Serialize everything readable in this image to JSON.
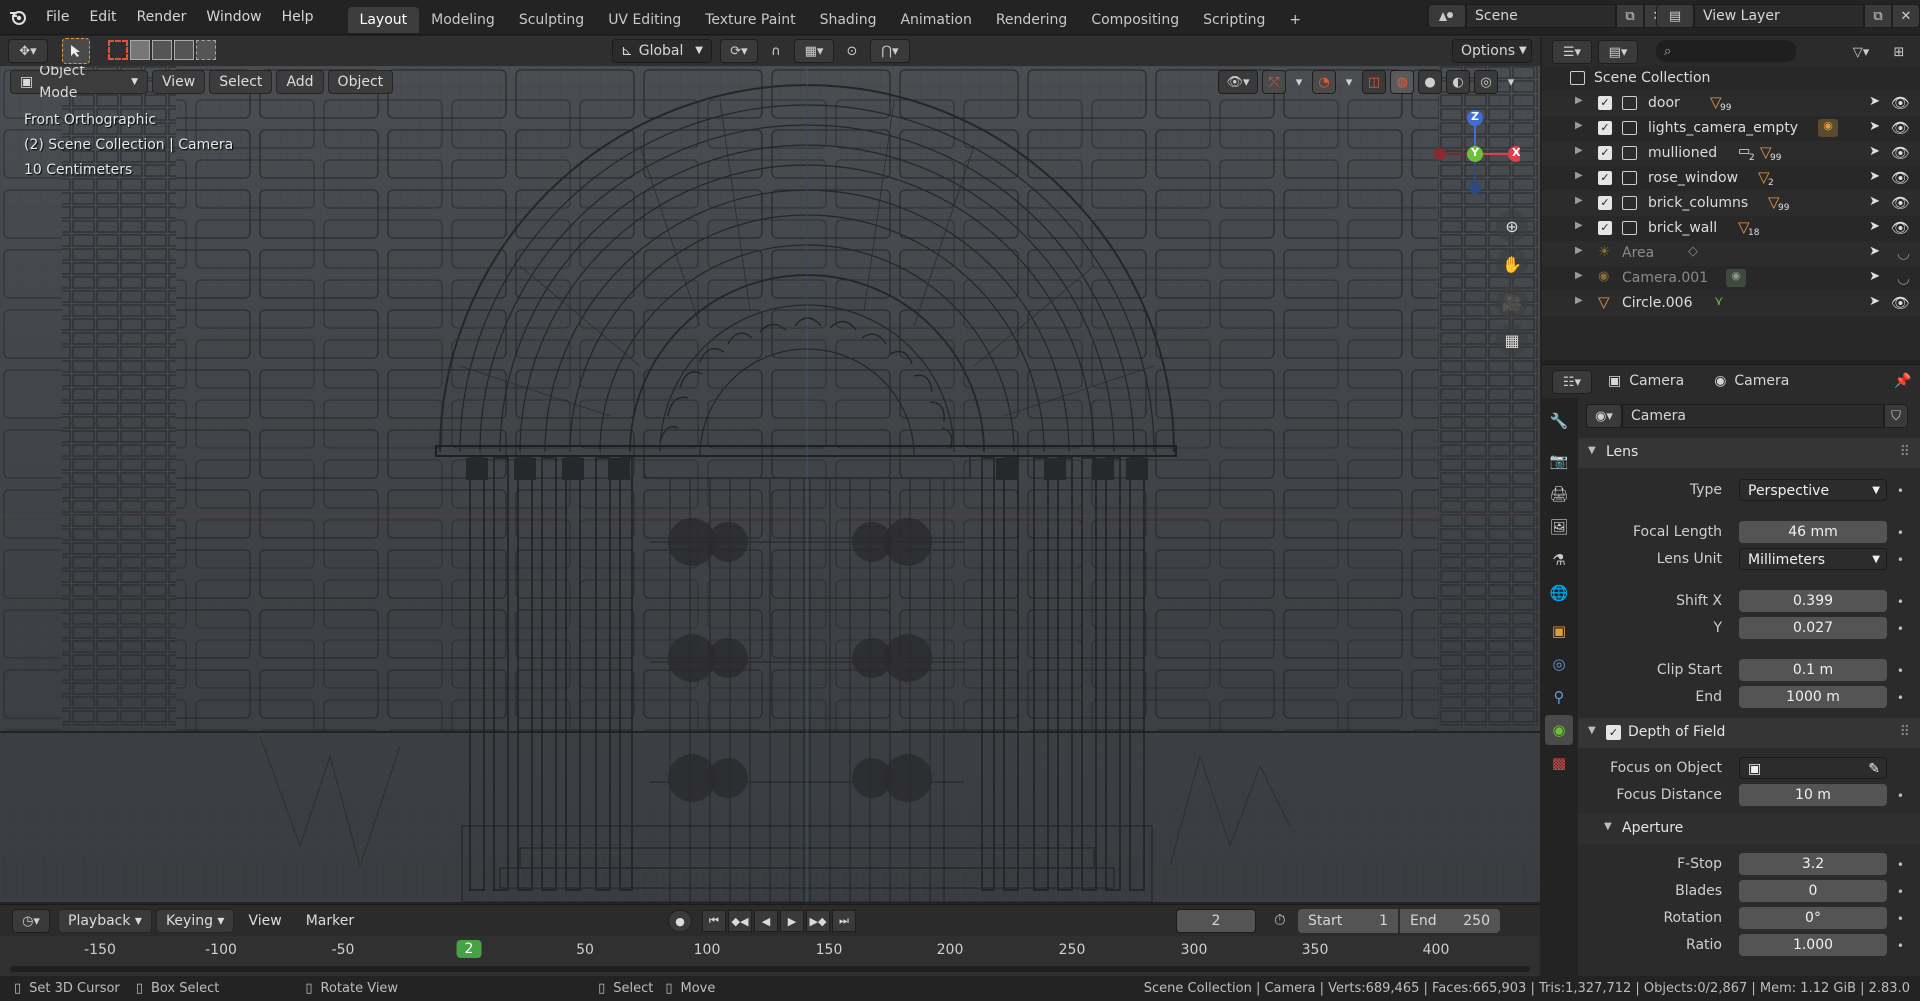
{
  "menubar": {
    "items": [
      "File",
      "Edit",
      "Render",
      "Window",
      "Help"
    ],
    "workspaces": [
      "Layout",
      "Modeling",
      "Sculpting",
      "UV Editing",
      "Texture Paint",
      "Shading",
      "Animation",
      "Rendering",
      "Compositing",
      "Scripting"
    ],
    "active_workspace": "Layout",
    "add_tab": "+",
    "scene": "Scene",
    "view_layer": "View Layer"
  },
  "tool_header": {
    "orientation": "Global",
    "options": "Options"
  },
  "viewport": {
    "mode": "Object Mode",
    "menus": [
      "View",
      "Select",
      "Add",
      "Object"
    ],
    "overlay_lines": [
      "Front Orthographic",
      "(2) Scene Collection | Camera",
      "10 Centimeters"
    ],
    "gizmo_axes": {
      "z": "Z",
      "y": "Y",
      "x": "X"
    }
  },
  "timeline": {
    "menus": [
      "Playback",
      "Keying",
      "View",
      "Marker"
    ],
    "current_frame": "2",
    "start_label": "Start",
    "start": "1",
    "end_label": "End",
    "end": "250",
    "ruler": [
      "-150",
      "-100",
      "-50",
      "2",
      "50",
      "100",
      "150",
      "200",
      "250",
      "300",
      "350",
      "400"
    ]
  },
  "statusbar": {
    "hints": [
      "Set 3D Cursor",
      "Box Select",
      "Rotate View",
      "Select",
      "Move"
    ],
    "stats": "Scene Collection | Camera | Verts:689,465 | Faces:665,903 | Tris:1,327,712 | Objects:0/2,867 | Mem: 1.12 GiB | 2.83.0"
  },
  "outliner": {
    "root": "Scene Collection",
    "rows": [
      {
        "name": "door",
        "badge": "99",
        "kind": "collection"
      },
      {
        "name": "lights_camera_empty",
        "badge": "",
        "kind": "collection"
      },
      {
        "name": "mullioned",
        "badge": "99",
        "badge2": "2",
        "kind": "collection"
      },
      {
        "name": "rose_window",
        "badge": "2",
        "kind": "collection"
      },
      {
        "name": "brick_columns",
        "badge": "99",
        "kind": "collection"
      },
      {
        "name": "brick_wall",
        "badge": "18",
        "kind": "collection"
      },
      {
        "name": "Area",
        "kind": "object-hidden"
      },
      {
        "name": "Camera.001",
        "kind": "object-hidden"
      },
      {
        "name": "Circle.006",
        "kind": "object"
      }
    ]
  },
  "properties": {
    "breadcrumb_object": "Camera",
    "breadcrumb_data": "Camera",
    "datablock": "Camera",
    "lens_panel": "Lens",
    "type_label": "Type",
    "type_value": "Perspective",
    "focal_label": "Focal Length",
    "focal_value": "46 mm",
    "lens_unit_label": "Lens Unit",
    "lens_unit_value": "Millimeters",
    "shiftx_label": "Shift X",
    "shiftx_value": "0.399",
    "shifty_label": "Y",
    "shifty_value": "0.027",
    "clipstart_label": "Clip Start",
    "clipstart_value": "0.1 m",
    "clipend_label": "End",
    "clipend_value": "1000 m",
    "dof_panel": "Depth of Field",
    "focus_obj_label": "Focus on Object",
    "focus_dist_label": "Focus Distance",
    "focus_dist_value": "10 m",
    "aperture_panel": "Aperture",
    "fstop_label": "F-Stop",
    "fstop_value": "3.2",
    "blades_label": "Blades",
    "blades_value": "0",
    "rotation_label": "Rotation",
    "rotation_value": "0°",
    "ratio_label": "Ratio",
    "ratio_value": "1.000"
  },
  "colors": {
    "accent": "#4772b3",
    "frame_green": "#47a244",
    "orange": "#e39a3f"
  }
}
